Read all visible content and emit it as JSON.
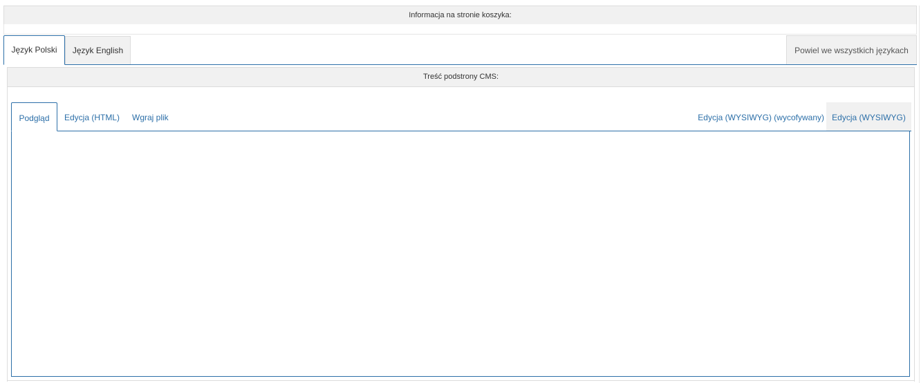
{
  "header": {
    "title": "Informacja na stronie koszyka:"
  },
  "language_tabs": {
    "items": [
      {
        "label": "Język Polski",
        "active": true
      },
      {
        "label": "Język English",
        "active": false
      }
    ],
    "copy_all_label": "Powiel we wszystkich językach"
  },
  "cms": {
    "title": "Treść podstrony CMS:",
    "tabs": [
      {
        "label": "Podgląd",
        "active": true
      },
      {
        "label": "Edycja (HTML)",
        "active": false
      },
      {
        "label": "Wgraj plik",
        "active": false
      },
      {
        "label": "Edycja (WYSIWYG) (wycofywany)",
        "active": false
      },
      {
        "label": "Edycja (WYSIWYG)",
        "active": false
      }
    ]
  },
  "colors": {
    "accent": "#2c6fa8",
    "header_bg": "#f1f1f1",
    "border": "#dcdcdc"
  }
}
